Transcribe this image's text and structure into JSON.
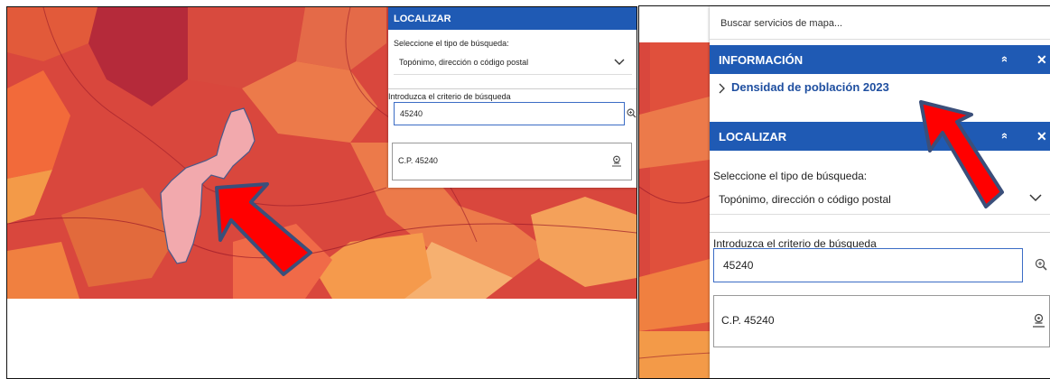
{
  "left": {
    "panel": {
      "title": "LOCALIZAR",
      "collapse_glyph": "»",
      "close_glyph": "✕",
      "type_label": "Seleccione el tipo de búsqueda:",
      "type_value": "Topónimo, dirección o código postal",
      "criteria_label": "Introduzca el criterio de búsqueda",
      "criteria_value": "45240",
      "result": "C.P. 45240"
    }
  },
  "right": {
    "search_placeholder": "Buscar servicios de mapa...",
    "info": {
      "title": "INFORMACIÓN",
      "layer_label": "Densidad de población 2023"
    },
    "locate": {
      "title": "LOCALIZAR",
      "type_label": "Seleccione el tipo de búsqueda:",
      "type_value": "Topónimo, dirección o código postal",
      "criteria_label": "Introduzca el criterio de búsqueda",
      "criteria_value": "45240",
      "result": "C.P. 45240"
    },
    "collapse_glyph": "»",
    "close_glyph": "✕"
  },
  "icons": [
    "zoom-icon",
    "locate-pin-icon",
    "chevron-down-icon",
    "chevron-right-icon",
    "arrow-pointer-icon"
  ],
  "colors": {
    "header_blue": "#1f5ab4",
    "link_blue": "#1f4fa0",
    "highlight_polygon": "#f2a9ad",
    "arrow_red": "#ff0000",
    "arrow_outline": "#3b4f7a"
  }
}
